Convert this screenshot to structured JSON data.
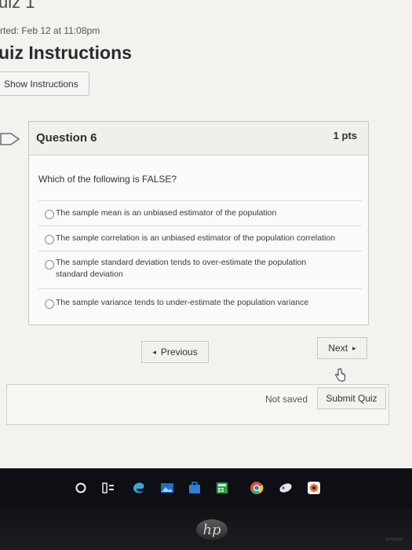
{
  "page": {
    "quiz_title_fragment": "uiz 1",
    "started_text": "rted: Feb 12 at 11:08pm",
    "instructions_title": "uiz Instructions",
    "show_instructions_label": "Show Instructions"
  },
  "question": {
    "title": "Question 6",
    "points": "1 pts",
    "text": "Which of the following is FALSE?",
    "answers": [
      {
        "label": "The sample mean is an unbiased estimator of the population"
      },
      {
        "label": "The sample correlation is an unbiased estimator of the population correlation"
      },
      {
        "label": "The sample standard deviation tends to over-estimate the population standard deviation"
      },
      {
        "label": "The sample variance tends to under-estimate the population variance"
      }
    ]
  },
  "navigation": {
    "previous_label": "Previous",
    "next_label": "Next",
    "previous_arrow": "◂",
    "next_arrow": "▸"
  },
  "footer": {
    "status": "Not saved",
    "submit_label": "Submit Quiz"
  },
  "taskbar": {
    "icons": [
      "start-icon",
      "task-view-icon",
      "edge-icon",
      "photos-icon",
      "store-icon",
      "calculator-icon",
      "chrome-icon",
      "app-icon",
      "security-icon"
    ]
  },
  "device": {
    "brand": "hp"
  },
  "colors": {
    "taskbar": "#0d0f14",
    "page_background": "#f3f2ee",
    "chrome_red": "#e04a3a",
    "chrome_green": "#3faa52",
    "chrome_yellow": "#f2c233",
    "store_blue": "#2f7fd6"
  }
}
